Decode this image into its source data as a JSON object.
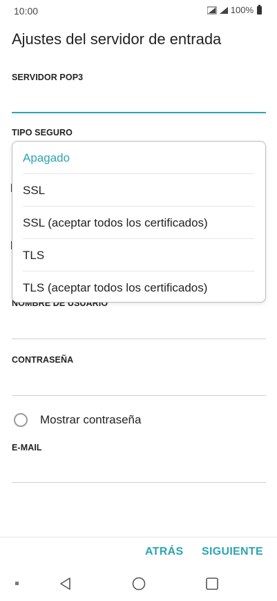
{
  "status_bar": {
    "time": "10:00",
    "battery": "100%"
  },
  "page": {
    "title": "Ajustes del servidor de entrada"
  },
  "fields": {
    "pop3_server": {
      "label": "SERVIDOR POP3",
      "value": ""
    },
    "security_type": {
      "label": "TIPO SEGURO"
    },
    "username": {
      "label": "NOMBRE DE USUARIO",
      "value": ""
    },
    "password": {
      "label": "CONTRASEÑA",
      "value": ""
    },
    "email": {
      "label": "E-MAIL",
      "value": ""
    }
  },
  "show_password": {
    "label": "Mostrar contraseña",
    "checked": false
  },
  "dropdown": {
    "options": [
      "Apagado",
      "SSL",
      "SSL (aceptar todos los certificados)",
      "TLS",
      "TLS (aceptar todos los certificados)"
    ],
    "selected": "Apagado"
  },
  "actions": {
    "back_label": "ATRÁS",
    "next_label": "SIGUIENTE"
  },
  "colors": {
    "accent": "#2aa5b3",
    "text": "#222222",
    "divider": "#cfcfcf"
  },
  "icons": [
    "cellular-signal-icon",
    "battery-icon",
    "radio-button-icon",
    "nav-back-icon",
    "nav-home-icon",
    "nav-recent-apps-icon"
  ]
}
